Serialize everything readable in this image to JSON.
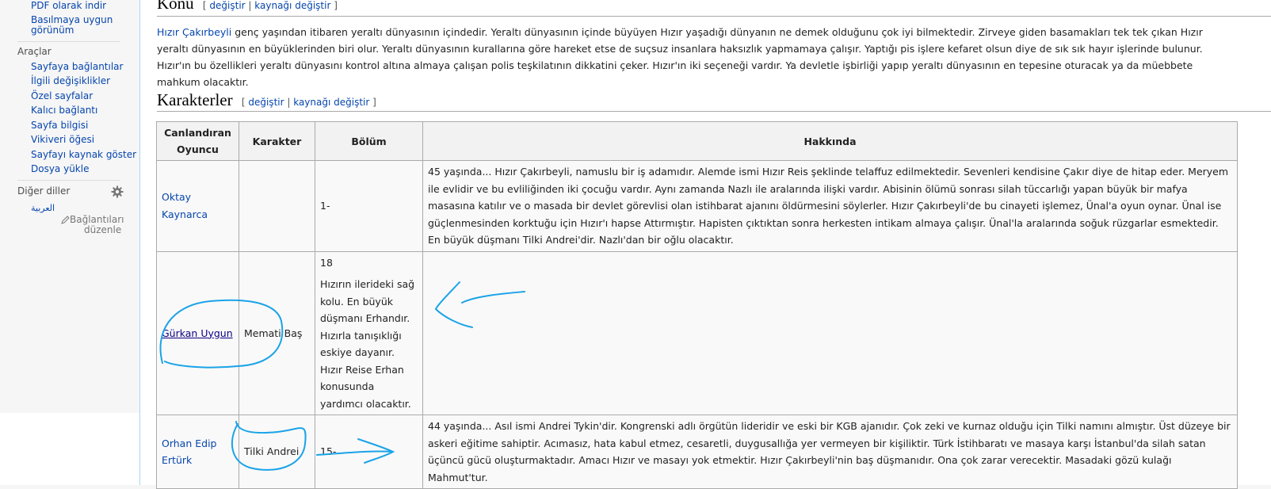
{
  "sidebar": {
    "print_items": [
      "PDF olarak indir",
      "Basılmaya uygun",
      "görünüm"
    ],
    "tools_heading": "Araçlar",
    "tools": [
      "Sayfaya bağlantılar",
      "İlgili değişiklikler",
      "Özel sayfalar",
      "Kalıcı bağlantı",
      "Sayfa bilgisi",
      "Vikiveri öğesi",
      "Sayfayı kaynak göster",
      "Dosya yükle"
    ],
    "languages_heading": "Diğer diller",
    "language_arabic": "العربية",
    "edit_links_line1": "Bağlantıları",
    "edit_links_line2": "düzenle"
  },
  "konu": {
    "title": "Konu",
    "edit_open": "[ ",
    "edit_label": "değiştir",
    "edit_sep": " | ",
    "edit_source_label": "kaynağı değiştir",
    "edit_close": " ]",
    "link_text": "Hızır Çakırbeyli",
    "text": " genç yaşından itibaren yeraltı dünyasının içindedir. Yeraltı dünyasının içinde büyüyen Hızır yaşadığı dünyanın ne demek olduğunu çok iyi bilmektedir. Zirveye giden basamakları tek tek çıkan Hızır yeraltı dünyasının en büyüklerinden biri olur. Yeraltı dünyasının kurallarına göre hareket etse de suçsuz insanlara haksızlık yapmamaya çalışır. Yaptığı pis işlere kefaret olsun diye de sık sık hayır işlerinde bulunur. Hızır'ın bu özellikleri yeraltı dünyasını kontrol altına almaya çalışan polis teşkilatının dikkatini çeker. Hızır'ın iki seçeneği vardır. Ya devletle işbirliği yapıp yeraltı dünyasının en tepesine oturacak ya da müebbete mahkum olacaktır."
  },
  "karakterler": {
    "title": "Karakterler",
    "edit_open": "[ ",
    "edit_label": "değiştir",
    "edit_sep": " | ",
    "edit_source_label": "kaynağı değiştir",
    "edit_close": " ]"
  },
  "table": {
    "headers": [
      "Canlandıran Oyuncu",
      "Karakter",
      "Bölüm",
      "Hakkında"
    ],
    "rows": [
      {
        "actor": "Oktay Kaynarca",
        "character": "",
        "episode": "1-",
        "episode_note": "",
        "about": "45 yaşında... Hızır Çakırbeyli, namuslu bir iş adamıdır. Alemde ismi Hızır Reis şeklinde telaffuz edilmektedir. Sevenleri kendisine Çakır diye de hitap eder. Meryem ile evlidir ve bu evliliğinden iki çocuğu vardır. Aynı zamanda Nazlı ile aralarında ilişki vardır. Abisinin ölümü sonrası silah tüccarlığı yapan büyük bir mafya masasına katılır ve o masada bir devlet görevlisi olan istihbarat ajanını öldürmesini söylerler. Hızır Çakırbeyli'de bu cinayeti işlemez, Ünal'a oyun oynar. Ünal ise güçlenmesinden korktuğu için Hızır'ı hapse Attırmıştır. Hapisten çıktıktan sonra herkesten intikam almaya çalışır. Ünal'la aralarında soğuk rüzgarlar esmektedir. En büyük düşmanı Tilki Andrei'dir. Nazlı'dan bir oğlu olacaktır."
      },
      {
        "actor": "Gürkan Uygun",
        "character": "Memati Baş",
        "episode": "18",
        "episode_note": "Hızırın ilerideki sağ kolu. En büyük düşmanı Erhandır. Hızırla tanışıklığı eskiye dayanır. Hızır Reise Erhan konusunda yardımcı olacaktır.",
        "about": ""
      },
      {
        "actor": "Orhan Edip Ertürk",
        "character": "Tilki Andrei",
        "episode": "15-",
        "episode_note": "",
        "about": "44 yaşında... Asıl ismi Andrei Tykin'dir. Kongrenski adlı örgütün lideridir ve eski bir KGB ajanıdır. Çok zeki ve kurnaz olduğu için Tilki namını almıştır. Üst düzeye bir askeri eğitime sahiptir. Acımasız, hata kabul etmez, cesaretli, duygusallığa yer vermeyen bir kişiliktir. Türk İstihbaratı ve masaya karşı İstanbul'da silah satan üçüncü gücü oluşturmaktadır. Amacı Hızır ve masayı yok etmektir. Hızır Çakırbeyli'nin baş düşmanıdır. Ona çok zarar verecektir. Masadaki gözü kulağı Mahmut'tur."
      }
    ]
  },
  "colors": {
    "link": "#0645ad",
    "annotation": "#1aa3e8",
    "header_bg": "#f2f2f2",
    "cell_bg": "#f9f9f9"
  },
  "icons": [
    "gear-icon",
    "pencil-icon"
  ]
}
